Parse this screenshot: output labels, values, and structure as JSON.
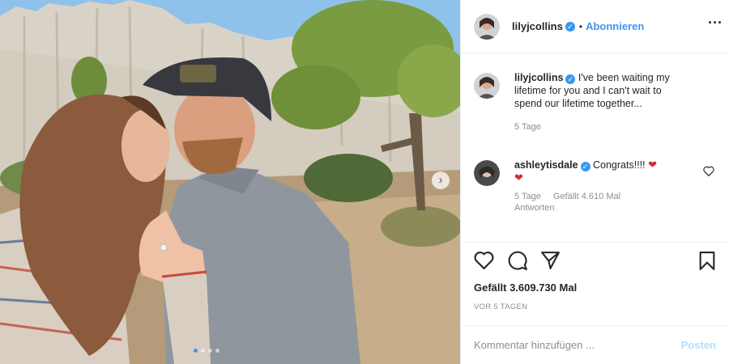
{
  "header": {
    "username": "lilyjcollins",
    "separator": "•",
    "follow_label": "Abonnieren",
    "more_icon": "more-options-icon"
  },
  "comments": [
    {
      "username": "lilyjcollins",
      "text": "I've been waiting my lifetime for you and I can't wait to spend our lifetime together...",
      "time": "5 Tage"
    },
    {
      "username": "ashleytisdale",
      "text": "Congrats!!!!",
      "time": "5 Tage",
      "likes": "Gefällt 4.610 Mal",
      "reply": "Antworten"
    }
  ],
  "actions": {
    "icons": [
      "heart-icon",
      "comment-icon",
      "share-icon",
      "bookmark-icon"
    ]
  },
  "likes": "Gefällt 3.609.730 Mal",
  "date": "VOR 5 TAGEN",
  "add_comment": {
    "placeholder": "Kommentar hinzufügen ...",
    "post_label": "Posten"
  },
  "colors": {
    "accent": "#3897f0",
    "post_disabled": "#b2dffc",
    "muted": "#8e8e8e",
    "text": "#262626"
  }
}
